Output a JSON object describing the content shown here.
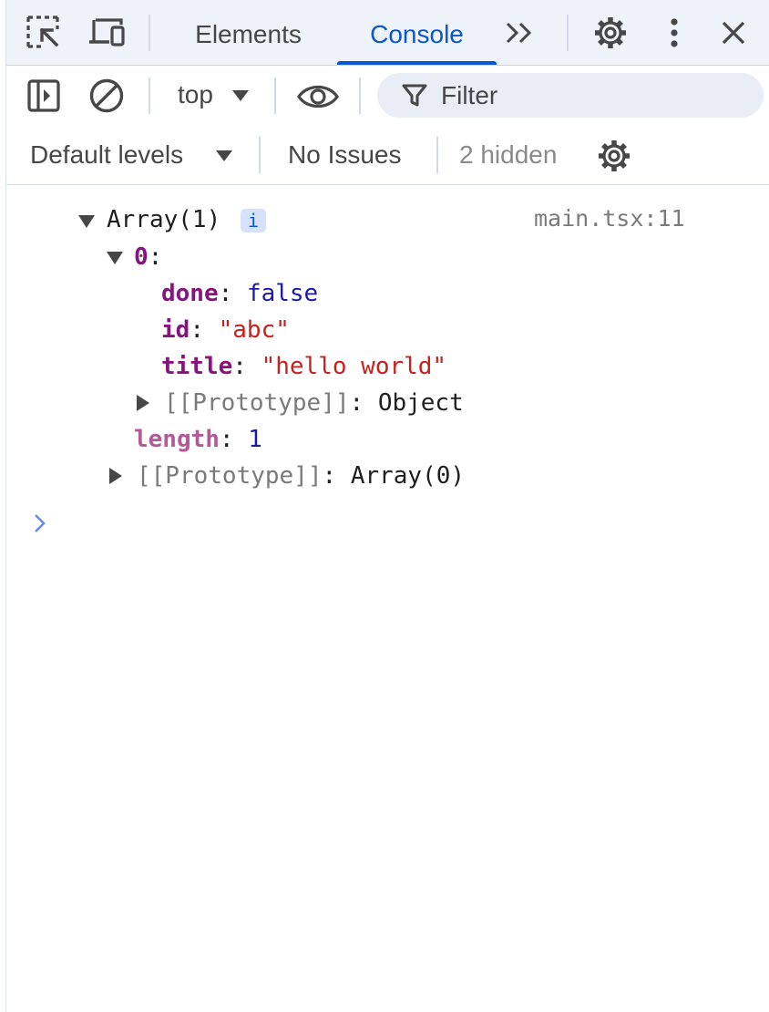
{
  "tabs": {
    "elements": "Elements",
    "console": "Console"
  },
  "toolbar": {
    "context": "top",
    "filter_placeholder": "Filter",
    "levels": "Default levels",
    "issues": "No Issues",
    "hidden": "2 hidden"
  },
  "log": {
    "source": "main.tsx:11",
    "array_label": "Array(1)",
    "info_badge": "i",
    "index_key": "0",
    "props": [
      {
        "key": "done",
        "value": "false"
      },
      {
        "key": "id",
        "value": "\"abc\""
      },
      {
        "key": "title",
        "value": "\"hello world\""
      }
    ],
    "item_proto_key": "[[Prototype]]",
    "item_proto_value": "Object",
    "length_key": "length",
    "length_value": "1",
    "array_proto_key": "[[Prototype]]",
    "array_proto_value": "Array(0)"
  },
  "colors": {
    "accent": "#0b57d0",
    "key": "#881280",
    "string": "#c5221f",
    "keyword": "#1a1aa6"
  },
  "icons": [
    "inspect-element-icon",
    "device-toolbar-icon",
    "more-tabs-icon",
    "settings-icon",
    "kebab-menu-icon",
    "close-icon",
    "sidebar-toggle-icon",
    "clear-console-icon",
    "eye-icon",
    "filter-icon",
    "console-settings-icon",
    "prompt-chevron-icon"
  ]
}
